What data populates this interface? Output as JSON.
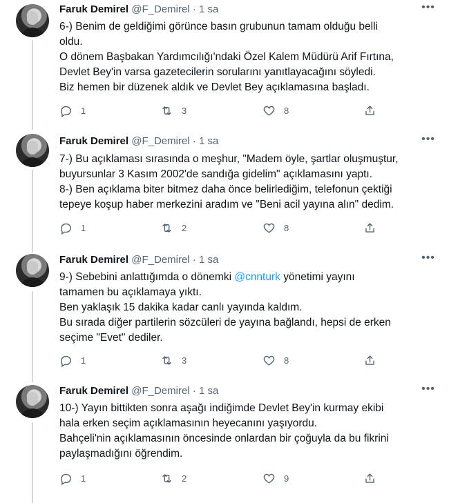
{
  "tweets": [
    {
      "author_name": "Faruk Demirel",
      "handle": "@F_Demirel",
      "sep": "·",
      "time": "1 sa",
      "avatar_icon": "profile-photo",
      "lines": [
        "6-) Benim de geldiğimi görünce basın grubunun tamam olduğu belli",
        "oldu.",
        "O dönem Başbakan Yardımcılığı'ndaki Özel Kalem Müdürü Arif Fırtına,",
        "Devlet Bey'in varsa gazetecilerin sorularını yanıtlayacağını söyledi.",
        "Biz hemen bir düzenek aldık ve Devlet Bey açıklamasına başladı."
      ],
      "replies": "1",
      "retweets": "3",
      "likes": "8"
    },
    {
      "author_name": "Faruk Demirel",
      "handle": "@F_Demirel",
      "sep": "·",
      "time": "1 sa",
      "avatar_icon": "profile-photo",
      "lines": [
        "7-) Bu açıklaması sırasında o meşhur, \"Madem öyle, şartlar oluşmuştur,",
        "buyursunlar 3 Kasım 2002'de sandığa gidelim\" açıklamasını yaptı.",
        "8-) Ben açıklama biter bitmez daha önce belirlediğim, telefonun çektiği",
        "tepeye koşup haber merkezini aradım ve \"Beni acil yayına alın\" dedim."
      ],
      "replies": "1",
      "retweets": "2",
      "likes": "8"
    },
    {
      "author_name": "Faruk Demirel",
      "handle": "@F_Demirel",
      "sep": "·",
      "time": "1 sa",
      "avatar_icon": "profile-photo",
      "line1_prefix": "9-) Sebebini anlattığımda o dönemki ",
      "line1_mention": "@cnnturk",
      "line1_suffix": " yönetimi yayını",
      "lines": [
        "tamamen bu açıklamaya yıktı.",
        "Ben yaklaşık 15 dakika kadar canlı yayında kaldım.",
        "Bu sırada diğer partilerin sözcüleri de yayına bağlandı, hepsi de erken",
        "seçime \"Evet\" dediler."
      ],
      "replies": "1",
      "retweets": "3",
      "likes": "8"
    },
    {
      "author_name": "Faruk Demirel",
      "handle": "@F_Demirel",
      "sep": "·",
      "time": "1 sa",
      "avatar_icon": "profile-photo",
      "lines": [
        "10-) Yayın bittikten sonra aşağı indiğimde Devlet Bey'in kurmay ekibi",
        "hala erken seçim açıklamasının heyecanını yaşıyordu.",
        "Bahçeli'nin açıklamasının öncesinde onlardan bir çoğuyla da bu fikrini",
        "paylaşmadığını öğrendim."
      ],
      "replies": "1",
      "retweets": "2",
      "likes": "9"
    }
  ],
  "colors": {
    "text": "#0f1419",
    "secondary": "#536471",
    "link": "#1d9bf0",
    "thread_line": "#cfd9de"
  },
  "icons": [
    "reply-icon",
    "retweet-icon",
    "like-icon",
    "share-icon",
    "more-icon"
  ]
}
